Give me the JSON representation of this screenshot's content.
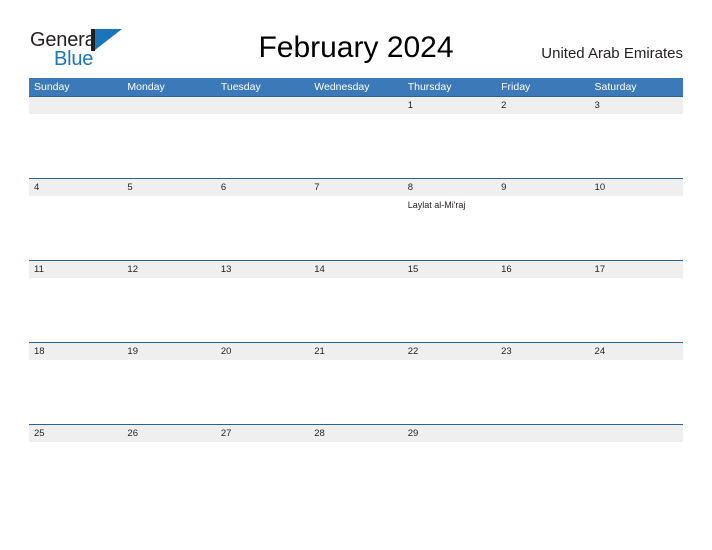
{
  "brand": {
    "name_part1": "General",
    "name_part2": "Blue",
    "flag_icon": "blue-flag-triangle",
    "color_dark": "#231f20",
    "color_blue": "#1b75bb"
  },
  "header": {
    "title": "February 2024",
    "region": "United Arab Emirates"
  },
  "calendar": {
    "header_bg": "#3b79b8",
    "band_bg": "#efefef",
    "rule_color": "#2b6095",
    "weekdays": [
      "Sunday",
      "Monday",
      "Tuesday",
      "Wednesday",
      "Thursday",
      "Friday",
      "Saturday"
    ],
    "weeks": [
      {
        "dates": [
          "",
          "",
          "",
          "",
          "1",
          "2",
          "3"
        ],
        "events": [
          "",
          "",
          "",
          "",
          "",
          "",
          ""
        ]
      },
      {
        "dates": [
          "4",
          "5",
          "6",
          "7",
          "8",
          "9",
          "10"
        ],
        "events": [
          "",
          "",
          "",
          "",
          "Laylat al-Mi'raj",
          "",
          ""
        ]
      },
      {
        "dates": [
          "11",
          "12",
          "13",
          "14",
          "15",
          "16",
          "17"
        ],
        "events": [
          "",
          "",
          "",
          "",
          "",
          "",
          ""
        ]
      },
      {
        "dates": [
          "18",
          "19",
          "20",
          "21",
          "22",
          "23",
          "24"
        ],
        "events": [
          "",
          "",
          "",
          "",
          "",
          "",
          ""
        ]
      },
      {
        "dates": [
          "25",
          "26",
          "27",
          "28",
          "29",
          "",
          ""
        ],
        "events": [
          "",
          "",
          "",
          "",
          "",
          "",
          ""
        ]
      }
    ]
  }
}
